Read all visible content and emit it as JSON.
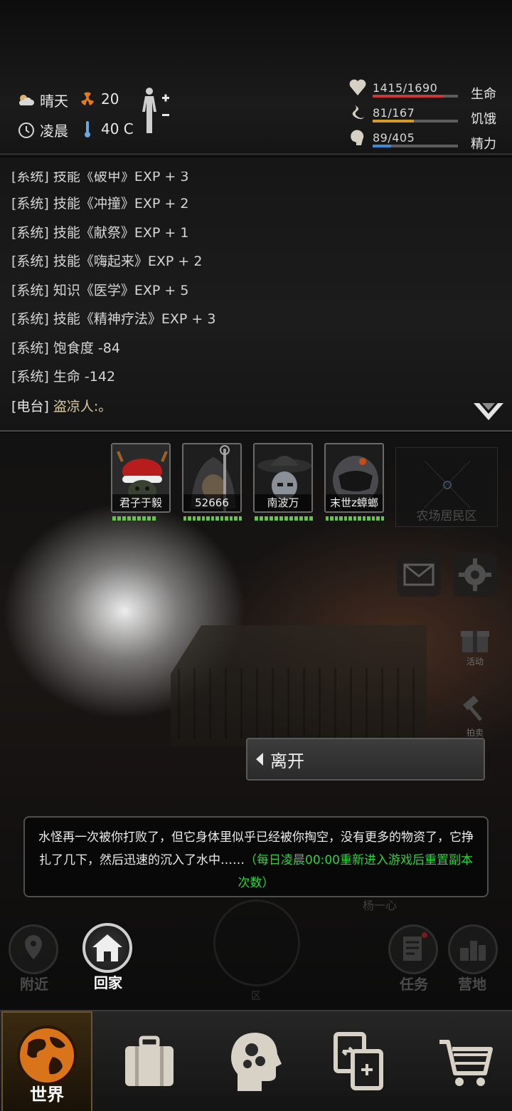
{
  "status": {
    "weather": "晴天",
    "radiation": "20",
    "time_of_day": "凌晨",
    "temperature": "40 C",
    "stats": [
      {
        "icon": "heart-icon",
        "value": "1415/1690",
        "label": "生命",
        "fill": 0.837,
        "color": "#c83a3a"
      },
      {
        "icon": "stomach-icon",
        "value": "81/167",
        "label": "饥饿",
        "fill": 0.485,
        "color": "#d79a2a"
      },
      {
        "icon": "brain-icon",
        "value": "89/405",
        "label": "精力",
        "fill": 0.22,
        "color": "#3a8ad6"
      }
    ]
  },
  "log": [
    {
      "tag": "[系统]",
      "msg": "技能《破甲》EXP + 3"
    },
    {
      "tag": "[系统]",
      "msg": "技能《冲撞》EXP + 2"
    },
    {
      "tag": "[系统]",
      "msg": "技能《献祭》EXP + 1"
    },
    {
      "tag": "[系统]",
      "msg": "技能《嗨起来》EXP + 2"
    },
    {
      "tag": "[系统]",
      "msg": "知识《医学》EXP + 5"
    },
    {
      "tag": "[系统]",
      "msg": "技能《精神疗法》EXP + 3"
    },
    {
      "tag": "[系统]",
      "msg": "饱食度 -84"
    },
    {
      "tag": "[系统]",
      "msg": "生命 -142"
    },
    {
      "tag": "[电台]",
      "msg": "盗凉人:。"
    }
  ],
  "party": [
    {
      "name": "君子于毅",
      "hp_segments": 9,
      "hp_filled": 9
    },
    {
      "name": "52666",
      "hp_segments": 13,
      "hp_filled": 13
    },
    {
      "name": "南波万",
      "hp_segments": 12,
      "hp_filled": 12
    },
    {
      "name": "末世z蟑螂",
      "hp_segments": 13,
      "hp_filled": 13
    }
  ],
  "area_name": "农场居民区",
  "side_buttons": {
    "activity": "活动",
    "auction": "拍卖"
  },
  "leave_label": "离开",
  "dialog": {
    "text": "水怪再一次被你打败了，但它身体里似乎已经被你掏空，没有更多的物资了，它挣扎了几下，然后迅速的沉入了水中……",
    "note": "（每日凌晨00:00重新进入游戏后重置副本次数）"
  },
  "ghost_name": "杨一心",
  "actions": {
    "nearby": "附近",
    "home": "回家",
    "task": "任务",
    "camp": "营地",
    "center_hint": "区"
  },
  "nav": {
    "world": "世界"
  },
  "colors": {
    "hp_dot": "#69c24c",
    "green_note": "#2bd43a",
    "accent_orange": "#e07a1a"
  }
}
